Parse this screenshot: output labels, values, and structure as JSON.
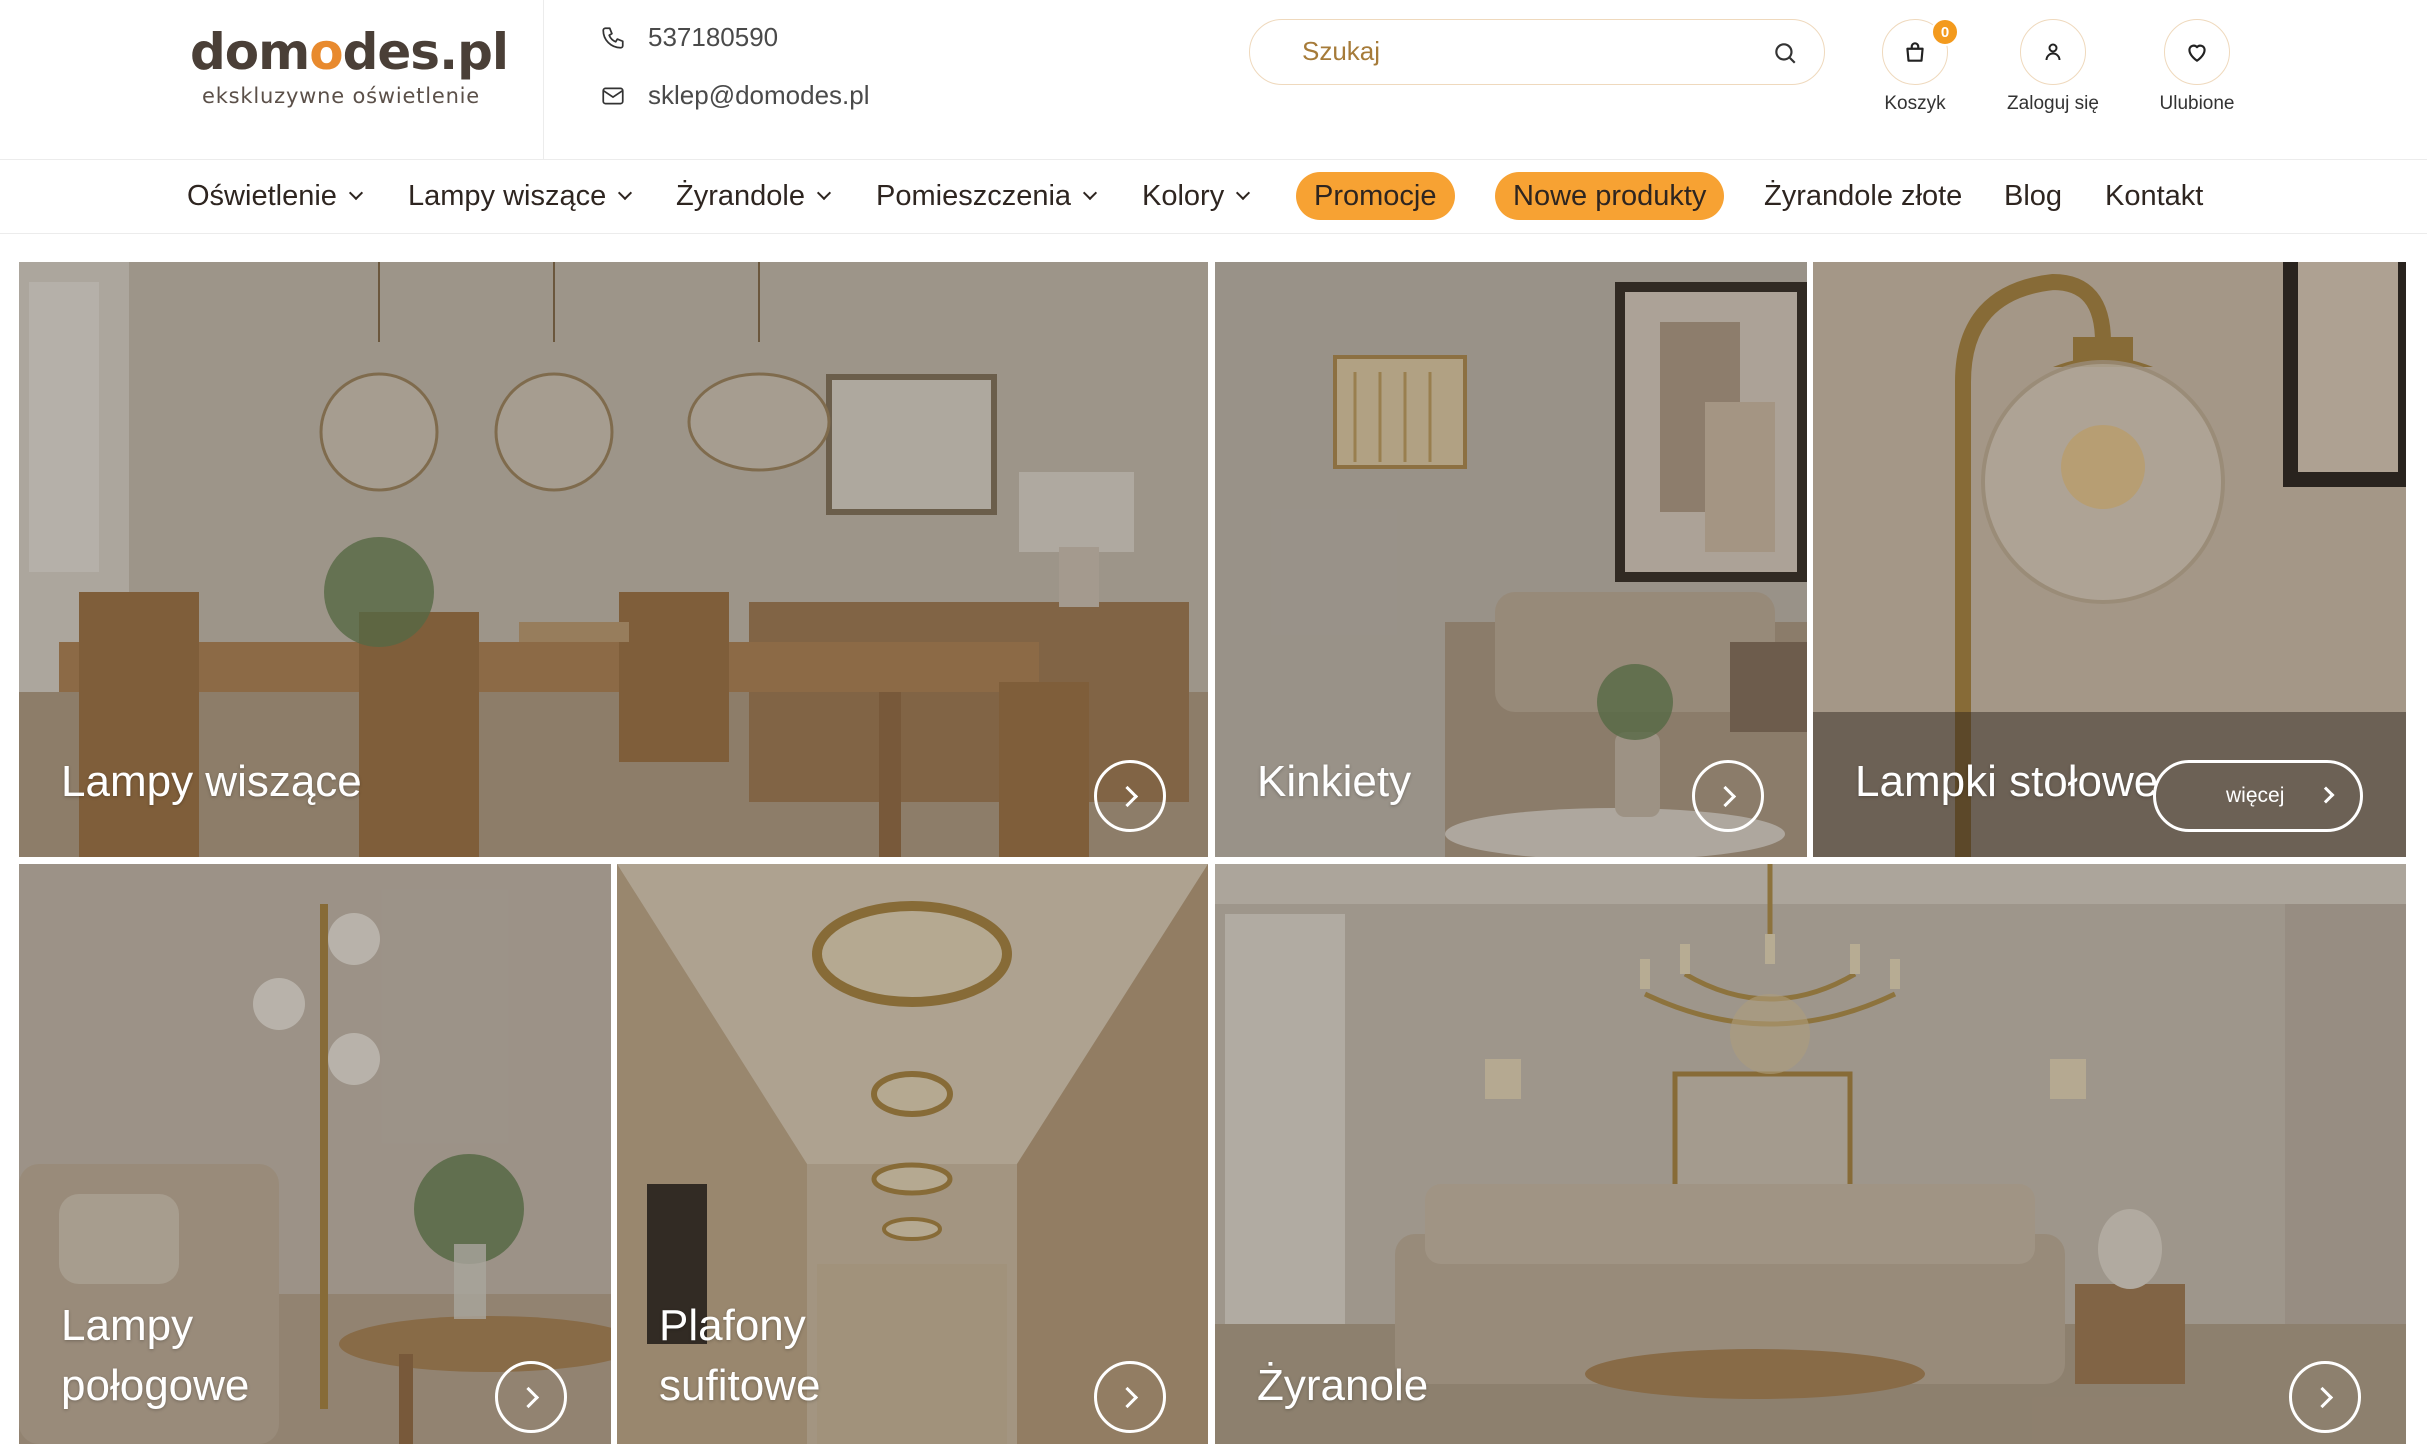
{
  "brand": {
    "name_part1": "dom",
    "name_o": "o",
    "name_part2": "des.pl",
    "tagline": "ekskluzywne oświetlenie"
  },
  "contact": {
    "phone": "537180590",
    "email": "sklep@domodes.pl"
  },
  "search": {
    "placeholder": "Szukaj"
  },
  "header_actions": {
    "cart_label": "Koszyk",
    "cart_count": "0",
    "login_label": "Zaloguj się",
    "favorites_label": "Ulubione"
  },
  "nav": {
    "items": [
      {
        "label": "Oświetlenie"
      },
      {
        "label": "Lampy wiszące"
      },
      {
        "label": "Żyrandole"
      },
      {
        "label": "Pomieszczenia"
      },
      {
        "label": "Kolory"
      },
      {
        "label": "Promocje"
      },
      {
        "label": "Nowe produkty"
      },
      {
        "label": "Żyrandole złote"
      },
      {
        "label": "Blog"
      },
      {
        "label": "Kontakt"
      }
    ]
  },
  "tiles": {
    "t1": {
      "label": "Lampy wiszące"
    },
    "t2": {
      "label": "Kinkiety"
    },
    "t3": {
      "label": "Lampki stołowe",
      "more_label": "więcej"
    },
    "t4": {
      "line1": "Lampy",
      "line2": "połogowe"
    },
    "t5": {
      "line1": "Plafony",
      "line2": "sufitowe"
    },
    "t6": {
      "label": "Żyranole"
    }
  },
  "colors": {
    "accent": "#f7a233",
    "badge": "#f39a1d",
    "brand_text": "#4a3f37",
    "search_border": "#efd9bd"
  }
}
